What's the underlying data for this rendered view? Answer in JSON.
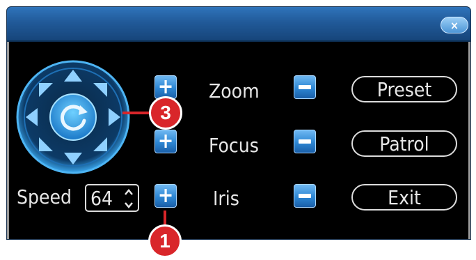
{
  "window": {
    "close_glyph": "×"
  },
  "ptz": {
    "rows": [
      {
        "label": "Zoom",
        "plus": "+",
        "action": "Preset"
      },
      {
        "label": "Focus",
        "plus": "+",
        "action": "Patrol"
      },
      {
        "label": "Iris",
        "plus": "+",
        "action": "Exit"
      }
    ],
    "speed_label": "Speed",
    "speed_value": "64"
  },
  "callouts": {
    "one": "1",
    "three": "3"
  },
  "colors": {
    "titlebar": "#215a99",
    "button_blue": "#2d86d3",
    "callout_red": "#d9262a",
    "joystick_glow": "#3aa7ee"
  },
  "icons": {
    "joystick": "directional-pad-icon",
    "center": "rotate-icon",
    "close": "close-icon"
  }
}
